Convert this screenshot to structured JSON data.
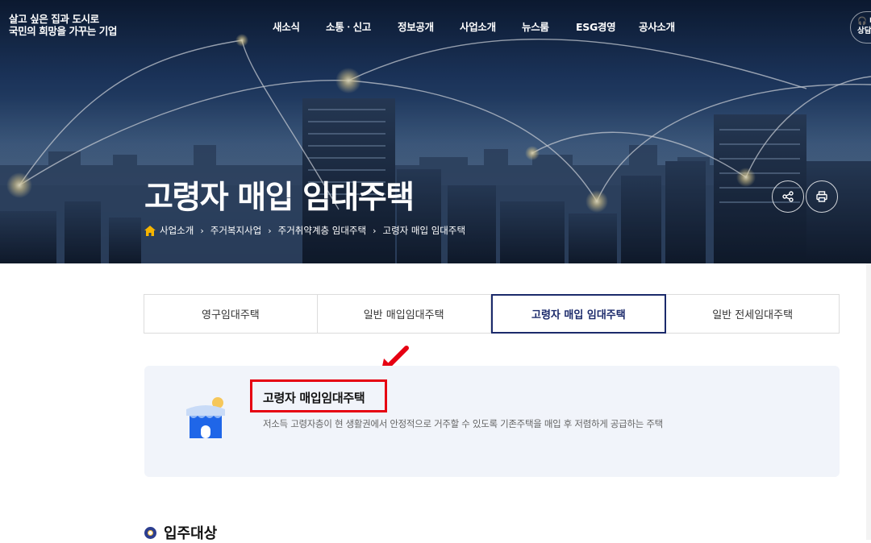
{
  "header": {
    "logo_line1": "살고 싶은 집과 도시로",
    "logo_line2": "국민의 희망을 가꾸는 기업",
    "nav": [
      "새소식",
      "소통ㆍ신고",
      "정보공개",
      "사업소개",
      "뉴스룸",
      "ESG경영",
      "공사소개"
    ],
    "consult_line1": "🎧 내",
    "consult_line2": "상담"
  },
  "hero": {
    "title": "고령자 매입 임대주택",
    "breadcrumb": [
      "사업소개",
      "주거복지사업",
      "주거취약계층 임대주택",
      "고령자 매입 임대주택"
    ],
    "share_icon": "share-icon",
    "print_icon": "print-icon"
  },
  "tabs": {
    "items": [
      "영구임대주택",
      "일반 매입임대주택",
      "고령자 매입 임대주택",
      "일반 전세임대주택"
    ],
    "active_index": 2
  },
  "info": {
    "title": "고령자 매입임대주택",
    "description": "저소득 고령자층이 현 생활권에서 안정적으로 거주할 수 있도록 기존주택을 매입 후 저렴하게 공급하는 주택",
    "icon": "house-icon"
  },
  "section": {
    "heading": "입주대상"
  },
  "colors": {
    "accent": "#1b2a6b",
    "highlight": "#e60012",
    "info_bg": "#f1f4fa"
  }
}
